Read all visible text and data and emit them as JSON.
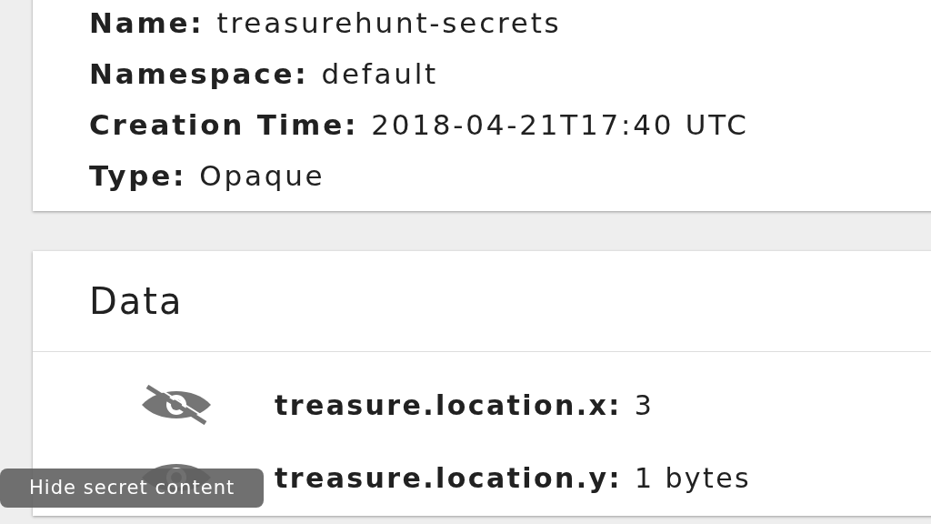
{
  "details": [
    {
      "label": "Name:",
      "value": "treasurehunt-secrets"
    },
    {
      "label": "Namespace:",
      "value": "default"
    },
    {
      "label": "Creation Time:",
      "value": "2018-04-21T17:40 UTC"
    },
    {
      "label": "Type:",
      "value": "Opaque"
    }
  ],
  "data": {
    "title": "Data",
    "entries": [
      {
        "key": "treasure.location.x:",
        "value": "3",
        "revealed": true
      },
      {
        "key": "treasure.location.y:",
        "value": "1 bytes",
        "revealed": false
      }
    ]
  },
  "tooltip": {
    "text": "Hide secret content"
  }
}
